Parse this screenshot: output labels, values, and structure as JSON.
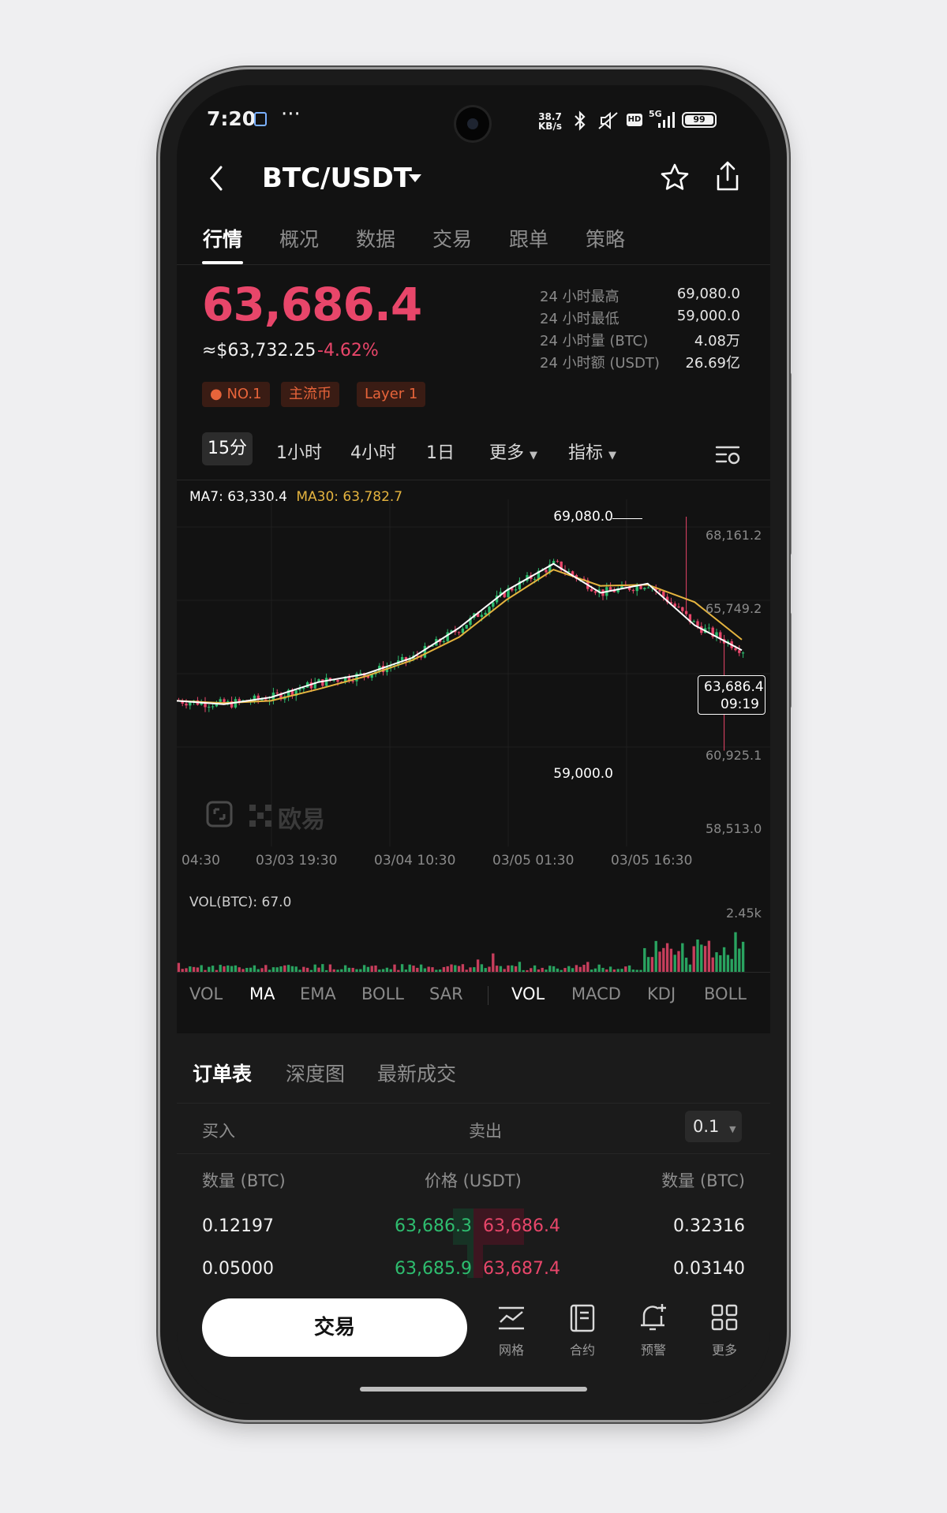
{
  "status_bar": {
    "time": "7:20",
    "more": "···",
    "net_speed_value": "38.7",
    "net_speed_unit": "KB/s",
    "battery": "99",
    "network": "5G"
  },
  "header": {
    "pair": "BTC/USDT"
  },
  "tabs": [
    {
      "label": "行情"
    },
    {
      "label": "概况"
    },
    {
      "label": "数据"
    },
    {
      "label": "交易"
    },
    {
      "label": "跟单"
    },
    {
      "label": "策略"
    }
  ],
  "ticker": {
    "last_price": "63,686.4",
    "usd_price": "≈$63,732.25",
    "change_pct": "-4.62%",
    "stats": [
      {
        "label": "24 小时最高",
        "value": "69,080.0"
      },
      {
        "label": "24 小时最低",
        "value": "59,000.0"
      },
      {
        "label": "24 小时量 (BTC)",
        "value": "4.08万"
      },
      {
        "label": "24 小时额 (USDT)",
        "value": "26.69亿"
      }
    ],
    "tags": [
      "NO.1",
      "主流币",
      "Layer 1"
    ]
  },
  "timeframes": {
    "active": "15分",
    "items": [
      "1小时",
      "4小时",
      "1日"
    ],
    "more": "更多",
    "indicators": "指标"
  },
  "chart_legend": {
    "ma7": "MA7: 63,330.4",
    "ma30": "MA30: 63,782.7"
  },
  "watermark": "欧易",
  "chart_data": {
    "type": "line",
    "series": [
      {
        "name": "MA7",
        "x": [
          "03/03 04:30",
          "03/03 12:00",
          "03/03 19:30",
          "03/04 03:00",
          "03/04 10:30",
          "03/04 18:00",
          "03/05 01:30",
          "03/05 09:00",
          "03/05 13:00",
          "03/05 16:30",
          "03/05 20:00",
          "03/06 01:00",
          "03/06 09:19"
        ],
        "values": [
          61150,
          61000,
          61300,
          61950,
          62300,
          63000,
          64300,
          65900,
          67050,
          65800,
          66200,
          64400,
          63330
        ]
      },
      {
        "name": "MA30",
        "x": [
          "03/03 04:30",
          "03/03 12:00",
          "03/03 19:30",
          "03/04 03:00",
          "03/04 10:30",
          "03/04 18:00",
          "03/05 01:30",
          "03/05 09:00",
          "03/05 13:00",
          "03/05 16:30",
          "03/05 20:00",
          "03/06 01:00",
          "03/06 09:19"
        ],
        "values": [
          61150,
          61050,
          61150,
          61650,
          62200,
          62900,
          63900,
          65500,
          66800,
          66100,
          66150,
          65400,
          63783
        ]
      }
    ],
    "high_marker": "69,080.0",
    "low_marker": "59,000.0",
    "current_price_label": "63,686.4",
    "current_time_label": "09:19",
    "y_ticks": [
      "68,161.2",
      "65,749.2",
      "60,925.1",
      "58,513.0"
    ],
    "x_ticks": [
      "04:30",
      "03/03 19:30",
      "03/04 10:30",
      "03/05 01:30",
      "03/05 16:30"
    ],
    "ylim": [
      58513,
      69080
    ]
  },
  "volume": {
    "label": "VOL(BTC): 67.0",
    "max_tick": "2.45k"
  },
  "indicator_tabs": {
    "main": [
      "VOL",
      "MA",
      "EMA",
      "BOLL",
      "SAR"
    ],
    "main_active": "MA",
    "sub": [
      "VOL",
      "MACD",
      "KDJ",
      "BOLL"
    ],
    "sub_active": "VOL"
  },
  "orderbook": {
    "tabs": [
      "订单表",
      "深度图",
      "最新成交"
    ],
    "buy_label": "买入",
    "sell_label": "卖出",
    "precision": "0.1",
    "headers": [
      "数量 (BTC)",
      "价格 (USDT)",
      "数量 (BTC)"
    ],
    "rows": [
      {
        "bid_qty": "0.12197",
        "bid_price": "63,686.3",
        "ask_price": "63,686.4",
        "ask_qty": "0.32316"
      },
      {
        "bid_qty": "0.05000",
        "bid_price": "63,685.9",
        "ask_price": "63,687.4",
        "ask_qty": "0.03140"
      }
    ]
  },
  "bottom_bar": {
    "trade": "交易",
    "items": [
      {
        "label": "网格",
        "icon": "grid-chart-icon"
      },
      {
        "label": "合约",
        "icon": "contract-icon"
      },
      {
        "label": "预警",
        "icon": "bell-plus-icon"
      },
      {
        "label": "更多",
        "icon": "apps-icon"
      }
    ]
  },
  "colors": {
    "down": "#e8466a",
    "up": "#2ebd6f",
    "ma7": "#ffffff",
    "ma30": "#e5b43f",
    "accent_tag": "#e7643a"
  }
}
